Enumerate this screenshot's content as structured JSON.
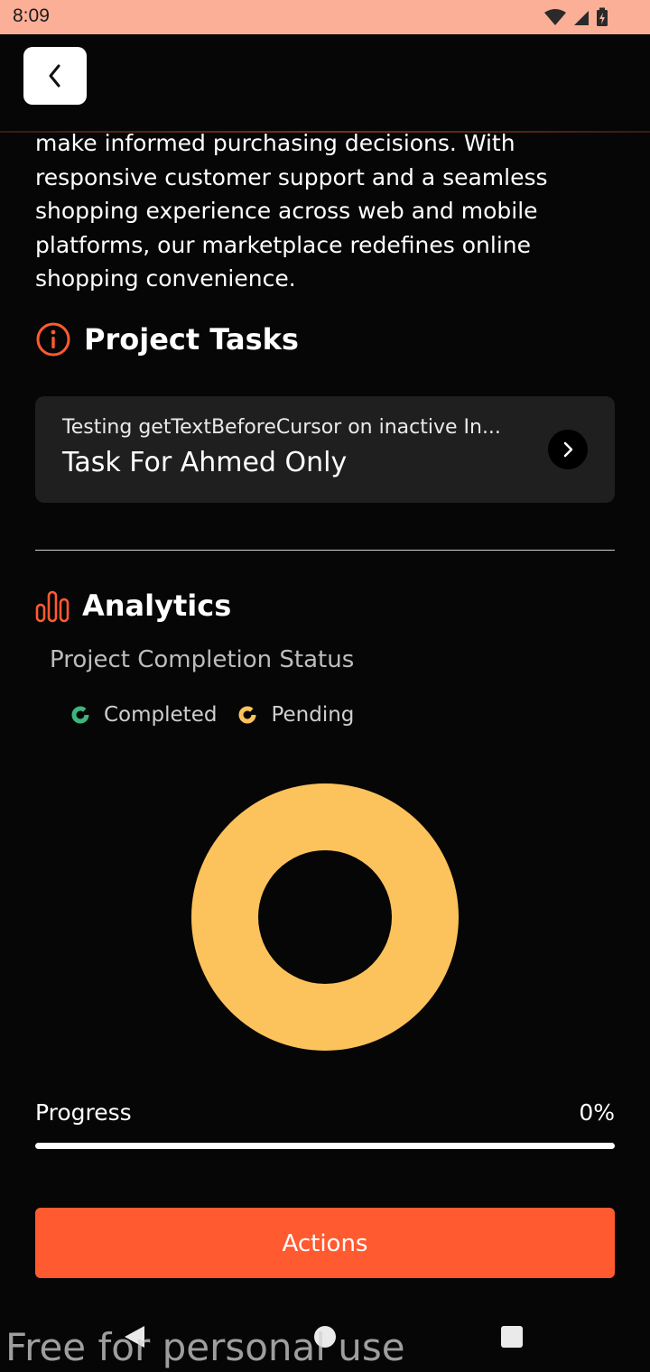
{
  "status_bar": {
    "time": "8:09"
  },
  "description_lines": [
    "make informed purchasing decisions. With",
    "responsive customer support and a seamless",
    "shopping experience across web and mobile",
    "platforms, our marketplace redefines online",
    "shopping convenience."
  ],
  "project_tasks": {
    "heading": "Project Tasks",
    "task": {
      "subtitle": "Testing getTextBeforeCursor on inactive In...",
      "title": "Task For Ahmed Only"
    }
  },
  "analytics": {
    "heading": "Analytics",
    "chart_title": "Project Completion Status",
    "legend": [
      {
        "label": "Completed",
        "color": "#3db57d"
      },
      {
        "label": "Pending",
        "color": "#fcc35c"
      }
    ]
  },
  "chart_data": {
    "type": "pie",
    "title": "Project Completion Status",
    "categories": [
      "Completed",
      "Pending"
    ],
    "values": [
      0,
      100
    ],
    "colors": [
      "#3db57d",
      "#fcc35c"
    ],
    "legend_position": "top-left"
  },
  "progress": {
    "label": "Progress",
    "value_text": "0%",
    "value": 0
  },
  "actions": {
    "label": "Actions"
  },
  "colors": {
    "accent": "#ff5a30",
    "background": "#060606",
    "status_bar": "#fcaf97",
    "card": "#1f1f1f"
  },
  "watermark": "Free for personal use"
}
